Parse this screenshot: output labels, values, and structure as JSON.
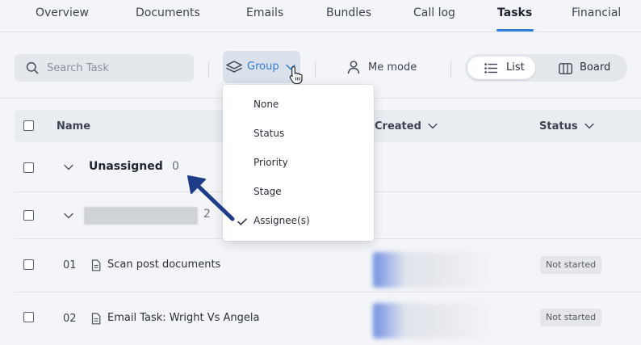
{
  "tabs": [
    {
      "label": "Overview"
    },
    {
      "label": "Documents"
    },
    {
      "label": "Emails"
    },
    {
      "label": "Bundles"
    },
    {
      "label": "Call log"
    },
    {
      "label": "Tasks"
    },
    {
      "label": "Financial"
    }
  ],
  "active_tab": "Tasks",
  "toolbar": {
    "search_placeholder": "Search Task",
    "group_label": "Group",
    "me_mode_label": "Me mode",
    "view_list_label": "List",
    "view_board_label": "Board"
  },
  "group_menu": {
    "items": [
      {
        "label": "None",
        "checked": false
      },
      {
        "label": "Status",
        "checked": false
      },
      {
        "label": "Priority",
        "checked": false
      },
      {
        "label": "Stage",
        "checked": false
      },
      {
        "label": "Assignee(s)",
        "checked": true
      }
    ]
  },
  "table": {
    "columns": [
      "Name",
      "Created",
      "Status"
    ],
    "groups": [
      {
        "title": "Unassigned",
        "count": "0"
      },
      {
        "title": "",
        "count": "2"
      }
    ],
    "tasks": [
      {
        "number": "01",
        "name": "Scan post documents",
        "status": "Not started"
      },
      {
        "number": "02",
        "name": "Email Task: Wright Vs Angela",
        "status": "Not started"
      }
    ]
  },
  "colors": {
    "accent": "#2f80d8",
    "annotation_arrow": "#1f3c88"
  }
}
